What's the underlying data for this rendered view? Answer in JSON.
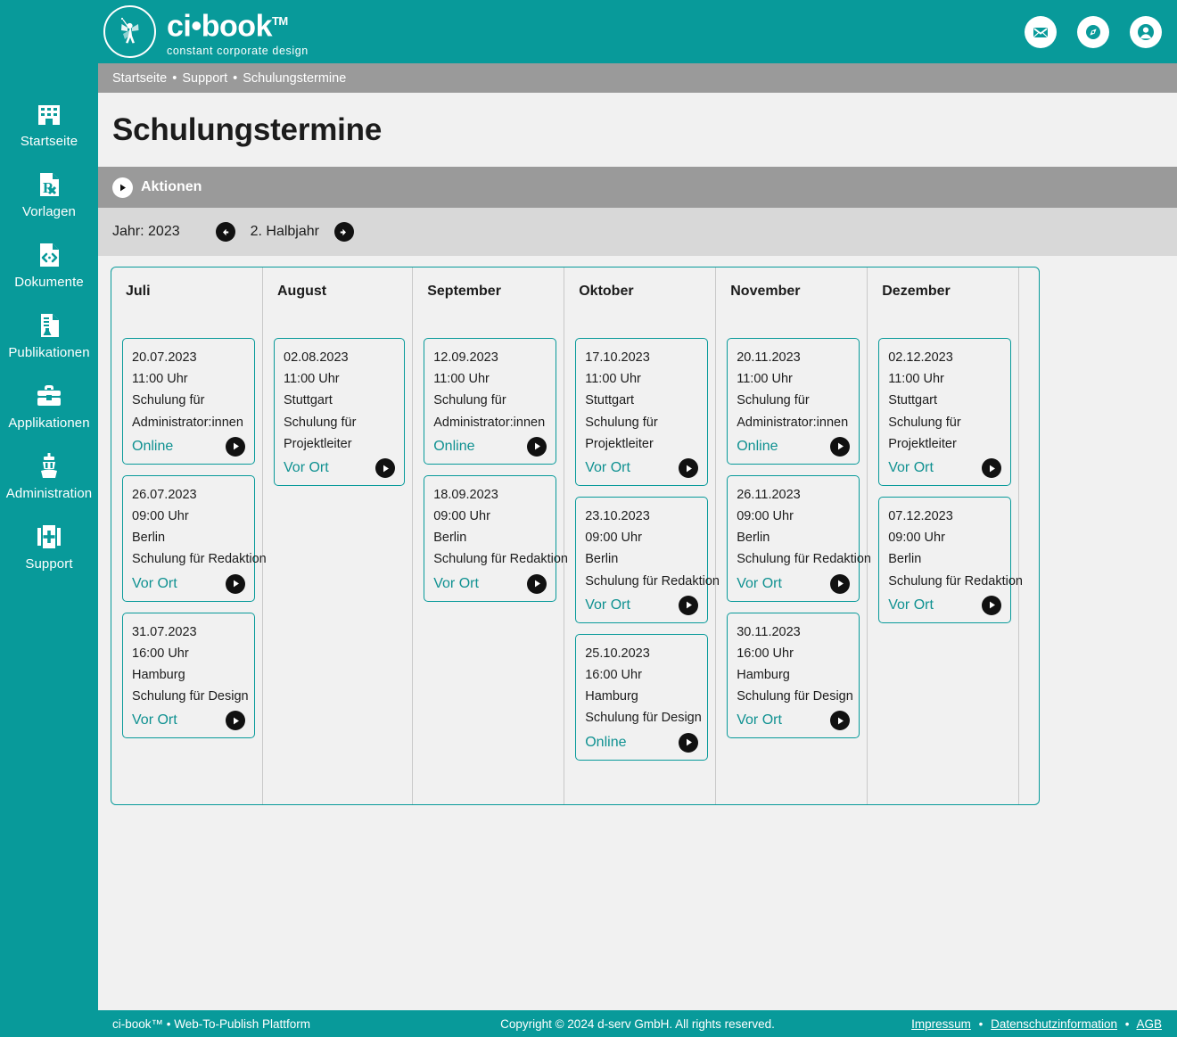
{
  "brand": {
    "name": "ci•book",
    "tm": "TM",
    "tagline": "constant corporate design",
    "logo_icon": "fairy-logo-icon"
  },
  "header": {
    "icons": [
      {
        "name": "mail-icon",
        "label": "Nachrichten"
      },
      {
        "name": "compass-icon",
        "label": "Navigator"
      },
      {
        "name": "user-account-icon",
        "label": "Benutzerkonto"
      }
    ]
  },
  "sidebar": {
    "items": [
      {
        "label": "Startseite",
        "icon": "building-icon"
      },
      {
        "label": "Vorlagen",
        "icon": "prescription-document-icon"
      },
      {
        "label": "Dokumente",
        "icon": "code-document-icon"
      },
      {
        "label": "Publikationen",
        "icon": "publication-document-icon"
      },
      {
        "label": "Applikationen",
        "icon": "toolbox-icon"
      },
      {
        "label": "Administration",
        "icon": "control-tower-icon"
      },
      {
        "label": "Support",
        "icon": "first-aid-kit-icon"
      }
    ]
  },
  "breadcrumb": {
    "items": [
      "Startseite",
      "Support",
      "Schulungstermine"
    ],
    "separator": "•"
  },
  "page": {
    "title": "Schulungstermine"
  },
  "actions": {
    "label": "Aktionen",
    "icon": "play-circle-icon"
  },
  "yearbar": {
    "year_label": "Jahr: 2023",
    "prev_icon": "arrow-left-circle-icon",
    "period_label": "2. Halbjahr",
    "next_icon": "arrow-right-circle-icon"
  },
  "calendar": {
    "months": [
      {
        "name": "Juli",
        "events": [
          {
            "date": "20.07.2023",
            "time": "11:00 Uhr",
            "location": "",
            "topic_lines": [
              "Schulung für",
              "Administrator:innen"
            ],
            "mode": "Online"
          },
          {
            "date": "26.07.2023",
            "time": "09:00 Uhr",
            "location": "Berlin",
            "topic_lines": [
              "Schulung für Redaktion"
            ],
            "mode": "Vor Ort"
          },
          {
            "date": "31.07.2023",
            "time": "16:00 Uhr",
            "location": "Hamburg",
            "topic_lines": [
              "Schulung für Design"
            ],
            "mode": "Vor Ort"
          }
        ]
      },
      {
        "name": "August",
        "events": [
          {
            "date": "02.08.2023",
            "time": "11:00 Uhr",
            "location": "Stuttgart",
            "topic_lines": [
              "Schulung für",
              "Projektleiter"
            ],
            "mode": "Vor Ort"
          }
        ]
      },
      {
        "name": "September",
        "events": [
          {
            "date": "12.09.2023",
            "time": "11:00 Uhr",
            "location": "",
            "topic_lines": [
              "Schulung für",
              "Administrator:innen"
            ],
            "mode": "Online"
          },
          {
            "date": "18.09.2023",
            "time": "09:00 Uhr",
            "location": "Berlin",
            "topic_lines": [
              "Schulung für Redaktion"
            ],
            "mode": "Vor Ort"
          }
        ]
      },
      {
        "name": "Oktober",
        "events": [
          {
            "date": "17.10.2023",
            "time": "11:00 Uhr",
            "location": "Stuttgart",
            "topic_lines": [
              "Schulung für",
              "Projektleiter"
            ],
            "mode": "Vor Ort"
          },
          {
            "date": "23.10.2023",
            "time": "09:00 Uhr",
            "location": "Berlin",
            "topic_lines": [
              "Schulung für Redaktion"
            ],
            "mode": "Vor Ort"
          },
          {
            "date": "25.10.2023",
            "time": "16:00 Uhr",
            "location": "Hamburg",
            "topic_lines": [
              "Schulung für Design"
            ],
            "mode": "Online"
          }
        ]
      },
      {
        "name": "November",
        "events": [
          {
            "date": "20.11.2023",
            "time": "11:00 Uhr",
            "location": "",
            "topic_lines": [
              "Schulung für",
              "Administrator:innen"
            ],
            "mode": "Online"
          },
          {
            "date": "26.11.2023",
            "time": "09:00 Uhr",
            "location": "Berlin",
            "topic_lines": [
              "Schulung für Redaktion"
            ],
            "mode": "Vor Ort"
          },
          {
            "date": "30.11.2023",
            "time": "16:00 Uhr",
            "location": "Hamburg",
            "topic_lines": [
              "Schulung für Design"
            ],
            "mode": "Vor Ort"
          }
        ]
      },
      {
        "name": "Dezember",
        "events": [
          {
            "date": "02.12.2023",
            "time": "11:00 Uhr",
            "location": "Stuttgart",
            "topic_lines": [
              "Schulung für",
              "Projektleiter"
            ],
            "mode": "Vor Ort"
          },
          {
            "date": "07.12.2023",
            "time": "09:00 Uhr",
            "location": "Berlin",
            "topic_lines": [
              "Schulung für Redaktion"
            ],
            "mode": "Vor Ort"
          }
        ]
      }
    ]
  },
  "footer": {
    "left": "ci-book™ • Web-To-Publish Plattform",
    "center": "Copyright © 2024 d-serv GmbH. All rights reserved.",
    "links": [
      "Impressum",
      "Datenschutzinformation",
      "AGB"
    ],
    "separator": "•"
  },
  "colors": {
    "brand_teal": "#089a9a",
    "bar_gray": "#9a9a9a",
    "subbar_gray": "#d8d8d8",
    "page_bg": "#f1f1f1",
    "link_teal": "#0f9191"
  }
}
